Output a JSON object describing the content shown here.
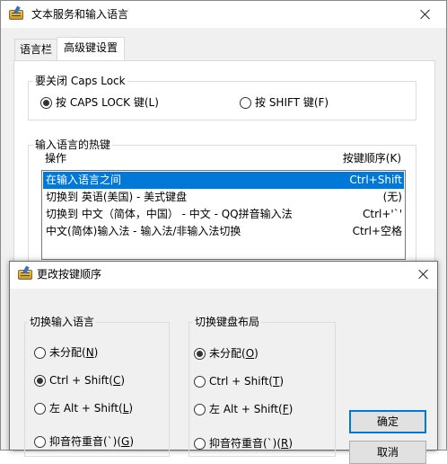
{
  "outer_window": {
    "title": "文本服务和输入语言",
    "tabs": [
      {
        "label": "语言栏",
        "active": false
      },
      {
        "label": "高级键设置",
        "active": true
      }
    ],
    "caps_group": {
      "title": "要关闭 Caps Lock",
      "options": [
        {
          "label": "按 CAPS LOCK 键(L)",
          "checked": true
        },
        {
          "label": "按 SHIFT 键(F)",
          "checked": false
        }
      ]
    },
    "hotkey_group": {
      "title": "输入语言的热键",
      "col_action": "操作",
      "col_sequence": "按键顺序(K)",
      "rows": [
        {
          "action": "在输入语言之间",
          "keys": "Ctrl+Shift",
          "selected": true
        },
        {
          "action": "切换到 英语(美国) - 美式键盘",
          "keys": "(无)",
          "selected": false
        },
        {
          "action": "切换到 中文（简体，中国） - 中文 - QQ拼音输入法",
          "keys": "Ctrl+'`'",
          "selected": false
        },
        {
          "action": "中文(简体)输入法 - 输入法/非输入法切换",
          "keys": "Ctrl+空格",
          "selected": false
        }
      ]
    }
  },
  "inner_dialog": {
    "title": "更改按键顺序",
    "language_group": {
      "title": "切换输入语言",
      "options": [
        {
          "text": "未分配(",
          "key": "N",
          "tail": ")",
          "checked": false
        },
        {
          "text": "Ctrl + Shift(",
          "key": "C",
          "tail": ")",
          "checked": true
        },
        {
          "text": "左 Alt + Shift(",
          "key": "L",
          "tail": ")",
          "checked": false
        },
        {
          "text": "抑音符重音(`)(",
          "key": "G",
          "tail": ")",
          "checked": false
        }
      ]
    },
    "layout_group": {
      "title": "切换键盘布局",
      "options": [
        {
          "text": "未分配(",
          "key": "O",
          "tail": ")",
          "checked": true
        },
        {
          "text": "Ctrl + Shift(",
          "key": "T",
          "tail": ")",
          "checked": false
        },
        {
          "text": "左 Alt + Shift(",
          "key": "F",
          "tail": ")",
          "checked": false
        },
        {
          "text": "抑音符重音(`)(",
          "key": "R",
          "tail": ")",
          "checked": false
        }
      ]
    },
    "ok_label": "确定",
    "cancel_label": "取消"
  },
  "icons": {
    "app": "keyboard-pen-icon",
    "close": "close-icon"
  }
}
